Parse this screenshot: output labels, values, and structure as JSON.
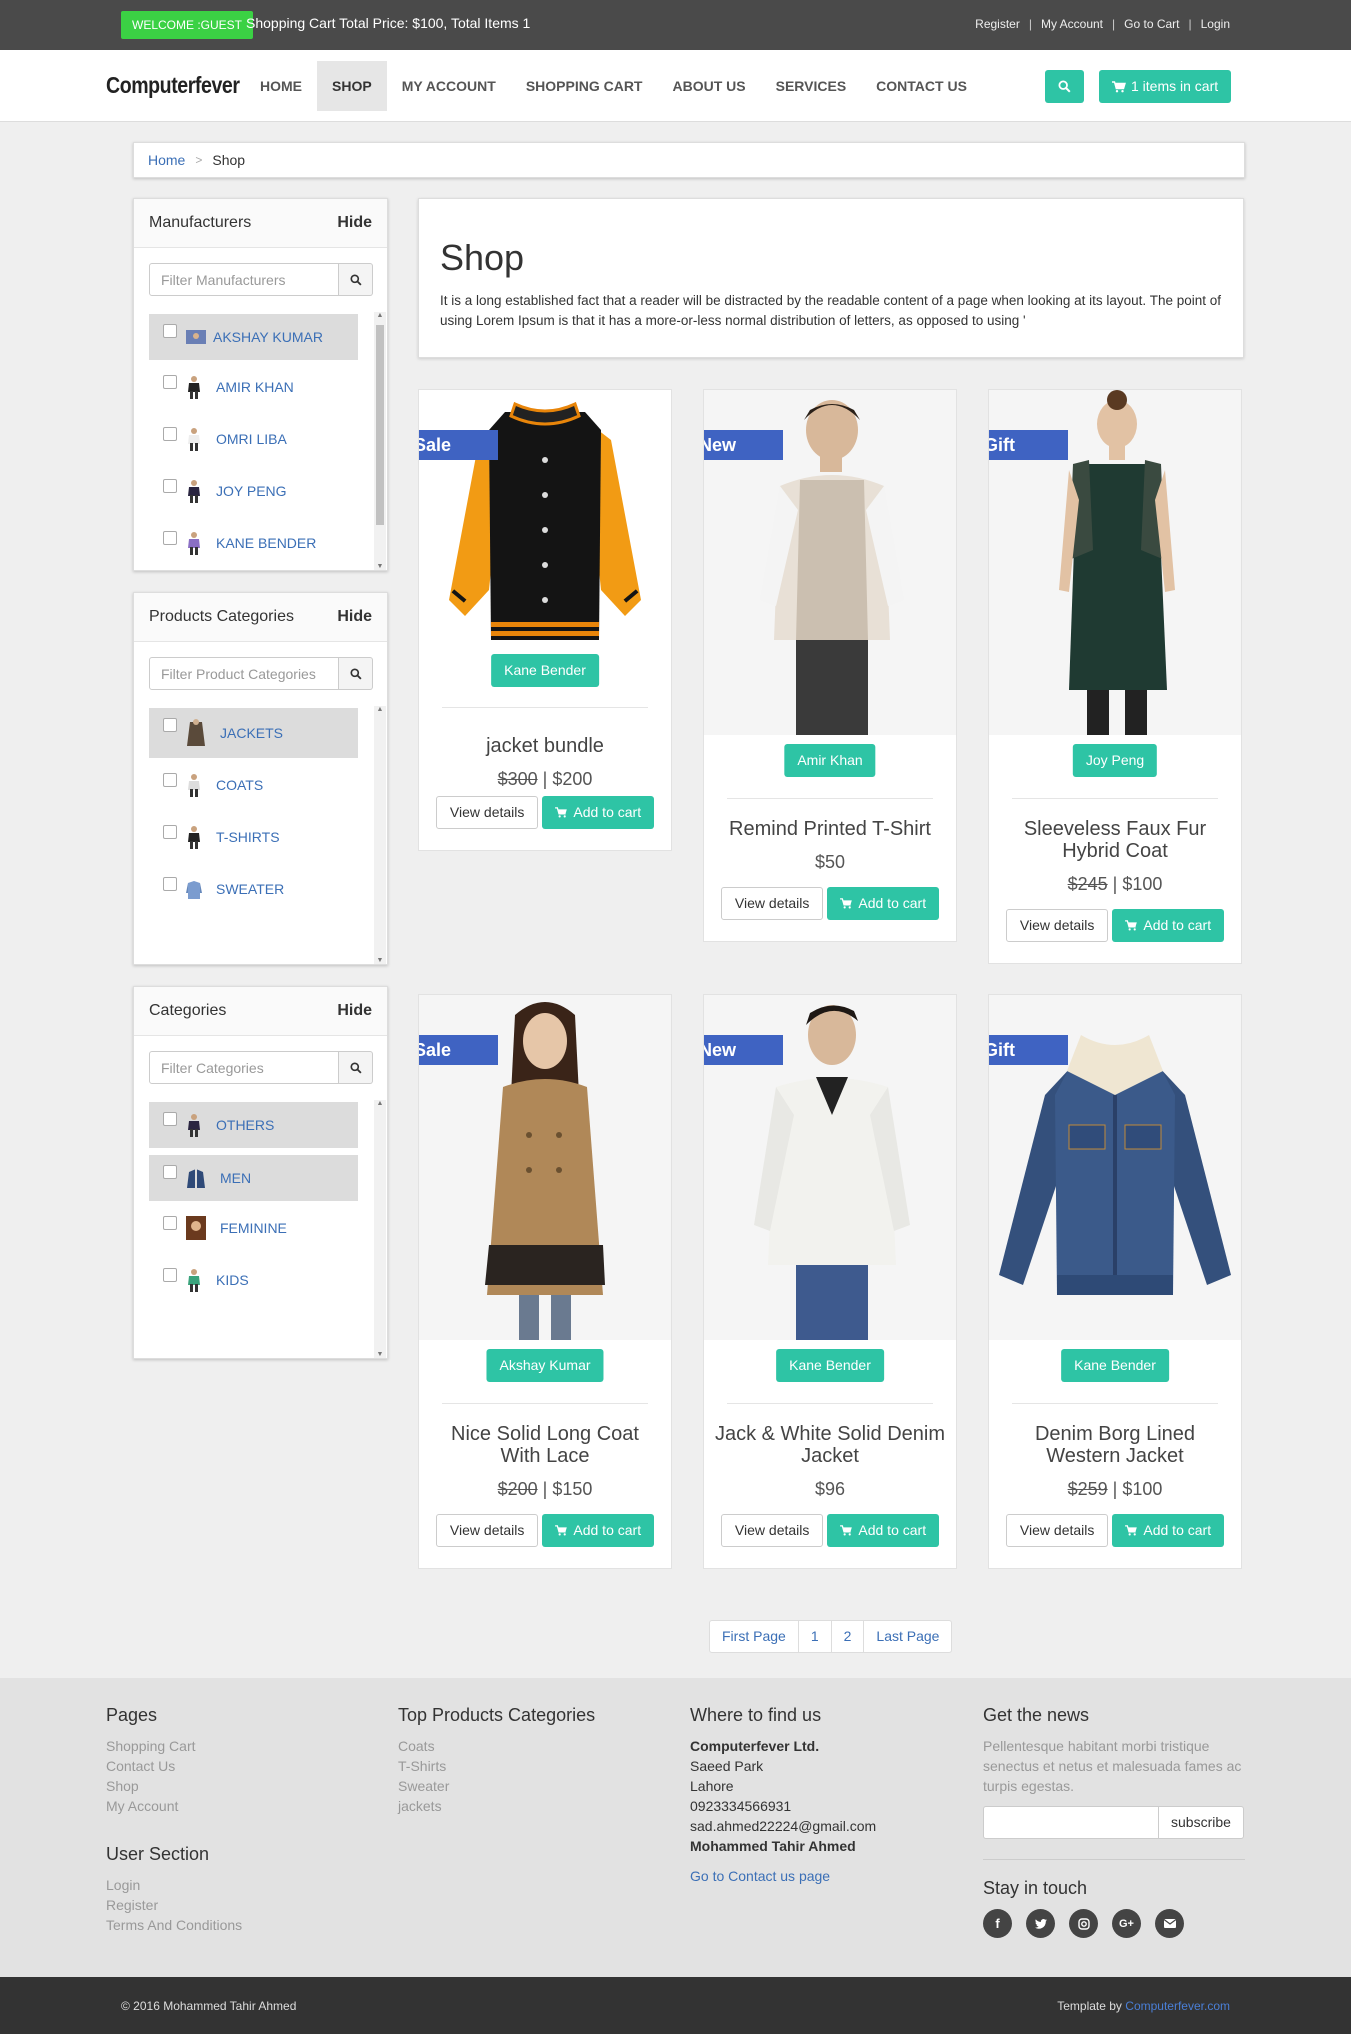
{
  "topbar": {
    "welcome": "WELCOME :GUEST",
    "cart_summary": "Shopping Cart Total Price: $100, Total Items 1",
    "links": [
      "Register",
      "My Account",
      "Go to Cart",
      "Login"
    ]
  },
  "navbar": {
    "brand": "Computerfever",
    "items": [
      "HOME",
      "SHOP",
      "MY ACCOUNT",
      "SHOPPING CART",
      "ABOUT US",
      "SERVICES",
      "CONTACT US"
    ],
    "active": "SHOP",
    "cart_button": "1 items in cart"
  },
  "breadcrumb": {
    "home": "Home",
    "current": "Shop"
  },
  "sidebar": {
    "manufacturers": {
      "title": "Manufacturers",
      "hide": "Hide",
      "placeholder": "Filter Manufacturers",
      "items": [
        "AKSHAY KUMAR",
        "AMIR KHAN",
        "OMRI LIBA",
        "JOY PENG",
        "KANE BENDER"
      ]
    },
    "product_categories": {
      "title": "Products Categories",
      "hide": "Hide",
      "placeholder": "Filter Product Categories",
      "items": [
        "JACKETS",
        "COATS",
        "T-SHIRTS",
        "SWEATER"
      ]
    },
    "categories": {
      "title": "Categories",
      "hide": "Hide",
      "placeholder": "Filter Categories",
      "items": [
        "OTHERS",
        "MEN",
        "FEMININE",
        "KIDS"
      ]
    }
  },
  "shop": {
    "title": "Shop",
    "description": "It is a long established fact that a reader will be distracted by the readable content of a page when looking at its layout. The point of using Lorem Ipsum is that it has a more-or-less normal distribution of letters, as opposed to using '"
  },
  "products": [
    {
      "ribbon": "Sale",
      "maker": "Kane Bender",
      "name": "jacket bundle",
      "old_price": "$300",
      "price": "$200"
    },
    {
      "ribbon": "New",
      "maker": "Amir Khan",
      "name": "Remind Printed T-Shirt",
      "old_price": "",
      "price": "$50"
    },
    {
      "ribbon": "Gift",
      "maker": "Joy Peng",
      "name": "Sleeveless Faux Fur Hybrid Coat",
      "old_price": "$245",
      "price": "$100"
    },
    {
      "ribbon": "Sale",
      "maker": "Akshay Kumar",
      "name": "Nice Solid Long Coat With Lace",
      "old_price": "$200",
      "price": "$150"
    },
    {
      "ribbon": "New",
      "maker": "Kane Bender",
      "name": "Jack & White Solid Denim Jacket",
      "old_price": "",
      "price": "$96"
    },
    {
      "ribbon": "Gift",
      "maker": "Kane Bender",
      "name": "Denim Borg Lined Western Jacket",
      "old_price": "$259",
      "price": "$100"
    }
  ],
  "buttons": {
    "view_details": "View details",
    "add_to_cart": "Add to cart"
  },
  "pagination": [
    "First Page",
    "1",
    "2",
    "Last Page"
  ],
  "footer": {
    "pages": {
      "title": "Pages",
      "links": [
        "Shopping Cart",
        "Contact Us",
        "Shop",
        "My Account"
      ]
    },
    "user": {
      "title": "User Section",
      "links": [
        "Login",
        "Register",
        "Terms And Conditions"
      ]
    },
    "top_categories": {
      "title": "Top Products Categories",
      "links": [
        "Coats",
        "T-Shirts",
        "Sweater",
        "jackets"
      ]
    },
    "find_us": {
      "title": "Where to find us",
      "company": "Computerfever Ltd.",
      "lines": [
        "Saeed Park",
        "Lahore",
        "0923334566931",
        "sad.ahmed22224@gmail.com"
      ],
      "person": "Mohammed Tahir Ahmed",
      "contact_link": "Go to Contact us page"
    },
    "news": {
      "title": "Get the news",
      "text": "Pellentesque habitant morbi tristique senectus et netus et malesuada fames ac turpis egestas.",
      "subscribe": "subscribe"
    },
    "stay": {
      "title": "Stay in touch",
      "icons": [
        "facebook-icon",
        "twitter-icon",
        "instagram-icon",
        "google-plus-icon",
        "envelope-icon"
      ]
    }
  },
  "bottombar": {
    "copyright": "© 2016 Mohammed Tahir Ahmed",
    "template_prefix": "Template by",
    "template_link": "Computerfever.com"
  },
  "colors": {
    "teal": "#2ec4a5",
    "ribbon": "#3f63c2",
    "welcome": "#3bd144",
    "topbar": "#4a4a4a"
  }
}
